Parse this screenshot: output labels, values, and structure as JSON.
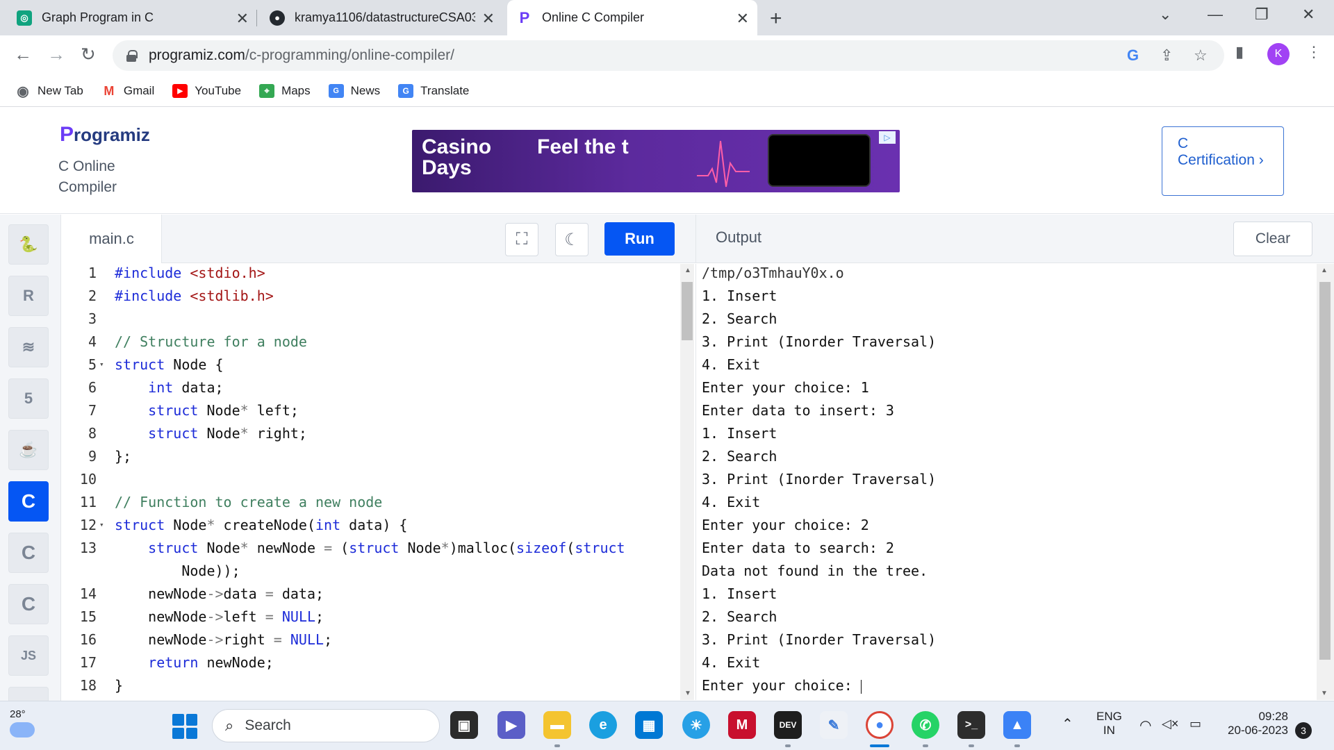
{
  "browser": {
    "tabs": [
      {
        "title": "Graph Program in C",
        "active": false
      },
      {
        "title": "kramya1106/datastructureCSA03",
        "active": false
      },
      {
        "title": "Online C Compiler",
        "active": true
      }
    ],
    "url_domain": "programiz.com",
    "url_path": "/c-programming/online-compiler/",
    "profile_initial": "K",
    "bookmarks": [
      "New Tab",
      "Gmail",
      "YouTube",
      "Maps",
      "News",
      "Translate"
    ]
  },
  "site": {
    "logo_text": "rogramiz",
    "logo_p": "P",
    "subtitle": "C Online Compiler",
    "ad_text_1": "Casino Days",
    "ad_text_2": "Feel the t",
    "certification": "C Certification ›"
  },
  "sidebar": {
    "langs": [
      {
        "name": "python",
        "glyph": "🐍",
        "active": false
      },
      {
        "name": "r",
        "glyph": "R",
        "active": false
      },
      {
        "name": "sql",
        "glyph": "≋",
        "active": false
      },
      {
        "name": "html",
        "glyph": "5",
        "active": false
      },
      {
        "name": "java",
        "glyph": "☕",
        "active": false
      },
      {
        "name": "c",
        "glyph": "C",
        "active": true
      },
      {
        "name": "cpp",
        "glyph": "C",
        "active": false
      },
      {
        "name": "csharp",
        "glyph": "C",
        "active": false
      },
      {
        "name": "js",
        "glyph": "JS",
        "active": false
      }
    ]
  },
  "editor": {
    "filename": "main.c",
    "run_label": "Run",
    "lines": [
      {
        "n": "1",
        "html": "<span class='kw'>#include</span> <span class='str'>&lt;stdio.h&gt;</span>"
      },
      {
        "n": "2",
        "html": "<span class='kw'>#include</span> <span class='str'>&lt;stdlib.h&gt;</span>"
      },
      {
        "n": "3",
        "html": ""
      },
      {
        "n": "4",
        "html": "<span class='cm'>// Structure for a node</span>"
      },
      {
        "n": "5",
        "fold": true,
        "html": "<span class='kw'>struct</span> Node {"
      },
      {
        "n": "6",
        "html": "    <span class='kw'>int</span> data;"
      },
      {
        "n": "7",
        "html": "    <span class='kw'>struct</span> Node<span class='op'>*</span> left;"
      },
      {
        "n": "8",
        "html": "    <span class='kw'>struct</span> Node<span class='op'>*</span> right;"
      },
      {
        "n": "9",
        "html": "};"
      },
      {
        "n": "10",
        "html": ""
      },
      {
        "n": "11",
        "html": "<span class='cm'>// Function to create a new node</span>"
      },
      {
        "n": "12",
        "fold": true,
        "html": "<span class='kw'>struct</span> Node<span class='op'>*</span> createNode(<span class='kw'>int</span> data) {"
      },
      {
        "n": "13",
        "html": "    <span class='kw'>struct</span> Node<span class='op'>*</span> newNode <span class='op'>=</span> (<span class='kw'>struct</span> Node<span class='op'>*</span>)malloc(<span class='kw'>sizeof</span>(<span class='kw'>struct</span>"
      },
      {
        "n": "",
        "html": "        Node));"
      },
      {
        "n": "14",
        "html": "    newNode<span class='op'>-&gt;</span>data <span class='op'>=</span> data;"
      },
      {
        "n": "15",
        "html": "    newNode<span class='op'>-&gt;</span>left <span class='op'>=</span> <span class='kw'>NULL</span>;"
      },
      {
        "n": "16",
        "html": "    newNode<span class='op'>-&gt;</span>right <span class='op'>=</span> <span class='kw'>NULL</span>;"
      },
      {
        "n": "17",
        "html": "    <span class='kw'>return</span> newNode;"
      },
      {
        "n": "18",
        "html": "}"
      }
    ]
  },
  "output": {
    "title": "Output",
    "clear_label": "Clear",
    "lines": [
      "/tmp/o3TmhauY0x.o",
      "1. Insert",
      "2. Search",
      "3. Print (Inorder Traversal)",
      "4. Exit",
      "Enter your choice: 1",
      "Enter data to insert: 3",
      "1. Insert",
      "2. Search",
      "3. Print (Inorder Traversal)",
      "4. Exit",
      "Enter your choice: 2",
      "Enter data to search: 2",
      "Data not found in the tree.",
      "1. Insert",
      "2. Search",
      "3. Print (Inorder Traversal)",
      "4. Exit",
      "Enter your choice: "
    ]
  },
  "taskbar": {
    "temperature": "28°",
    "search_placeholder": "Search",
    "lang_1": "ENG",
    "lang_2": "IN",
    "time": "09:28",
    "date": "20-06-2023",
    "notifications": "3"
  }
}
